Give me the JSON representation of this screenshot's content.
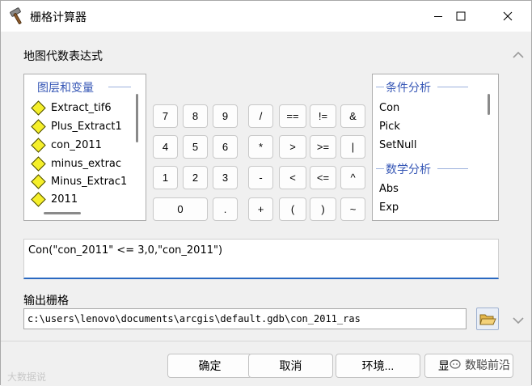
{
  "window": {
    "title": "栅格计算器"
  },
  "main": {
    "expression_label": "地图代数表达式",
    "layers": {
      "group_title": "图层和变量",
      "items": [
        "Extract_tif6",
        "Plus_Extract1",
        "con_2011",
        "minus_extrac",
        "Minus_Extrac1",
        "2011"
      ]
    },
    "keypad": {
      "row1": [
        "7",
        "8",
        "9",
        "/",
        "==",
        "!=",
        "&"
      ],
      "row2": [
        "4",
        "5",
        "6",
        "*",
        ">",
        ">=",
        "|"
      ],
      "row3": [
        "1",
        "2",
        "3",
        "-",
        "<",
        "<=",
        "^"
      ],
      "row4": [
        "0",
        ".",
        "+",
        "(",
        ")",
        "~"
      ]
    },
    "functions": {
      "group1_title": "条件分析",
      "group1_items": [
        "Con",
        "Pick",
        "SetNull"
      ],
      "group2_title": "数学分析",
      "group2_items": [
        "Abs",
        "Exp"
      ]
    },
    "expression_text": "Con(\"con_2011\"  <= 3,0,\"con_2011\")",
    "output_label": "输出栅格",
    "output_path": "c:\\users\\lenovo\\documents\\arcgis\\default.gdb\\con_2011_ras"
  },
  "footer": {
    "ok_label": "确定",
    "cancel_label": "取消",
    "env_label": "环境...",
    "help_partial": "显",
    "watermark_right": "数聪前沿",
    "watermark_left": "大数据说"
  },
  "icons": {
    "title": "hammer-icon",
    "minimize": "minimize-icon",
    "maximize": "maximize-icon",
    "close": "close-icon",
    "folder": "open-folder-icon",
    "layer": "layer-diamond-icon"
  }
}
